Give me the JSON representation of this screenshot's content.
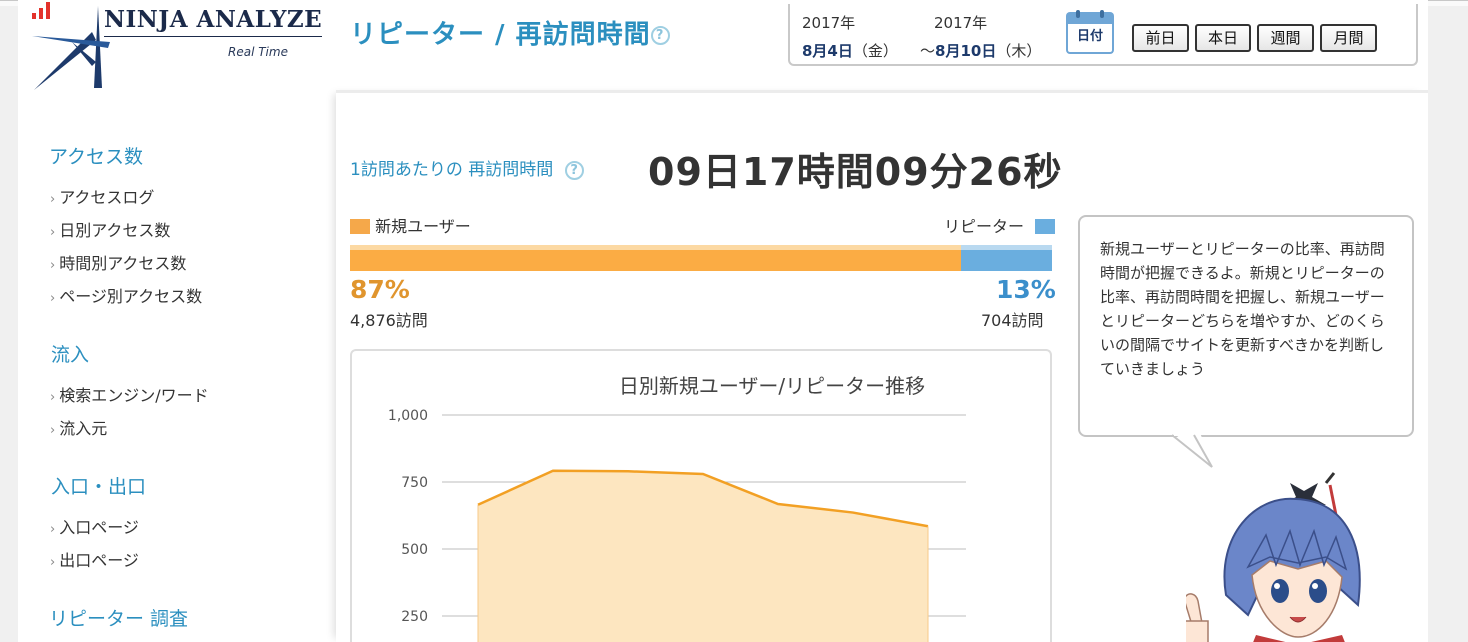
{
  "logo": {
    "name": "NINJA ANALYZE",
    "subtitle": "Real Time"
  },
  "header": {
    "title": "リピーター / 再訪問時間"
  },
  "date_range": {
    "start_year": "2017年",
    "start_date": "8月4日",
    "start_day": "（金）",
    "end_year": "2017年",
    "end_prefix": "～",
    "end_date": "8月10日",
    "end_day": "（木）",
    "calendar_label": "日付"
  },
  "period_buttons": [
    "前日",
    "本日",
    "週間",
    "月間"
  ],
  "sidebar": {
    "sections": [
      {
        "title": "アクセス数",
        "items": [
          "アクセスログ",
          "日別アクセス数",
          "時間別アクセス数",
          "ページ別アクセス数"
        ]
      },
      {
        "title": "流入",
        "items": [
          "検索エンジン/ワード",
          "流入元"
        ]
      },
      {
        "title": "入口・出口",
        "items": [
          "入口ページ",
          "出口ページ"
        ]
      },
      {
        "title": "リピーター 調査",
        "items": []
      }
    ]
  },
  "revisit": {
    "label": "1訪問あたりの 再訪問時間",
    "value": "09日17時間09分26秒"
  },
  "ratio": {
    "new_label": "新規ユーザー",
    "rep_label": "リピーター",
    "new_pct_text": "87%",
    "rep_pct_text": "13%",
    "new_fraction": 0.87,
    "new_visits": "4,876訪問",
    "rep_visits": "704訪問",
    "new_color": "#fbac44",
    "rep_color": "#6aaedf"
  },
  "bubble_text": "新規ユーザーとリピーターの比率、再訪問時間が把握できるよ。新規とリピーターの比率、再訪問時間を把握し、新規ユーザーとリピーターどちらを増やすか、どのくらいの間隔でサイトを更新すべきかを判断していきましょう",
  "chart_data": {
    "type": "area",
    "title": "日別新規ユーザー/リピーター推移",
    "y_ticks": [
      "1,000",
      "750",
      "500",
      "250"
    ],
    "ylim": [
      0,
      1000
    ],
    "grid": true,
    "series": [
      {
        "values": [
          665,
          792,
          790,
          780,
          668,
          636,
          585
        ],
        "color": "#f2a024"
      }
    ]
  }
}
